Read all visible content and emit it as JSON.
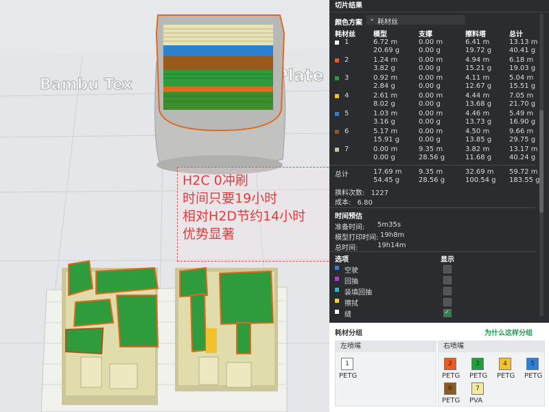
{
  "viewport": {
    "plate_label": "Bambu Tex",
    "plate_label_right": "Plate",
    "annotation": [
      "H2C 0冲刷",
      "时间只要19小时",
      "相对H2D节约14小时",
      "优势显著"
    ],
    "colors": {
      "plate_top": "#f3f3f0",
      "plate_side": "#b9bab7",
      "green": "#2e9b3c",
      "orange": "#dd6a1e",
      "cream": "#e8e3b4",
      "brown": "#9a5a1c",
      "blue": "#2d7fcf",
      "tan": "#c9b98a",
      "gray_model": "#c6c6c4"
    }
  },
  "panel": {
    "title": "切片结果",
    "color_scheme_label": "颜色方案",
    "color_scheme_value": "耗材丝",
    "columns": [
      "耗材丝",
      "模型",
      "支撑",
      "擦料塔",
      "总计"
    ],
    "filaments": [
      {
        "id": "1",
        "color": "#ffffff",
        "model_m": "6.72 m",
        "model_g": "20.69 g",
        "support_m": "0.00 m",
        "support_g": "0.00 g",
        "tower_m": "6.41 m",
        "tower_g": "19.72 g",
        "total_m": "13.13 m",
        "total_g": "40.41 g"
      },
      {
        "id": "2",
        "color": "#ea5b20",
        "model_m": "1.24 m",
        "model_g": "3.82 g",
        "support_m": "0.00 m",
        "support_g": "0.00 g",
        "tower_m": "4.94 m",
        "tower_g": "15.21 g",
        "total_m": "6.18 m",
        "total_g": "19.03 g"
      },
      {
        "id": "3",
        "color": "#1fa040",
        "model_m": "0.92 m",
        "model_g": "2.84 g",
        "support_m": "0.00 m",
        "support_g": "0.00 g",
        "tower_m": "4.11 m",
        "tower_g": "12.67 g",
        "total_m": "5.04 m",
        "total_g": "15.51 g"
      },
      {
        "id": "4",
        "color": "#f2c12e",
        "model_m": "2.61 m",
        "model_g": "8.02 g",
        "support_m": "0.00 m",
        "support_g": "0.00 g",
        "tower_m": "4.44 m",
        "tower_g": "13.68 g",
        "total_m": "7.05 m",
        "total_g": "21.70 g"
      },
      {
        "id": "5",
        "color": "#2f7fd6",
        "model_m": "1.03 m",
        "model_g": "3.16 g",
        "support_m": "0.00 m",
        "support_g": "0.00 g",
        "tower_m": "4.46 m",
        "tower_g": "13.73 g",
        "total_m": "5.49 m",
        "total_g": "16.90 g"
      },
      {
        "id": "6",
        "color": "#8b5a1e",
        "model_m": "5.17 m",
        "model_g": "15.91 g",
        "support_m": "0.00 m",
        "support_g": "0.00 g",
        "tower_m": "4.50 m",
        "tower_g": "13.85 g",
        "total_m": "9.66 m",
        "total_g": "29.75 g"
      },
      {
        "id": "7",
        "color": "#c8c0a0",
        "model_m": "0.00 m",
        "model_g": "0.00 g",
        "support_m": "9.35 m",
        "support_g": "28.56 g",
        "tower_m": "3.82 m",
        "tower_g": "11.68 g",
        "total_m": "13.17 m",
        "total_g": "40.24 g"
      }
    ],
    "totals": {
      "label": "总计",
      "model_m": "17.69 m",
      "model_g": "54.45 g",
      "support_m": "9.35 m",
      "support_g": "28.56 g",
      "tower_m": "32.69 m",
      "tower_g": "100.54 g",
      "total_m": "59.72 m",
      "total_g": "183.55 g"
    },
    "change_count": {
      "label": "换料次数:",
      "value": "1227"
    },
    "cost": {
      "label": "成本:",
      "value": "6.80"
    },
    "time": {
      "title": "时间预估",
      "prep_label": "准备时间:",
      "prep_value": "5m35s",
      "print_label": "模型打印时间:",
      "print_value": "19h8m",
      "total_label": "总时间:",
      "total_value": "19h14m"
    },
    "options": {
      "title": "选项",
      "show_label": "显示",
      "items": [
        {
          "label": "空驶",
          "color": "#3a7bd5",
          "checked": false
        },
        {
          "label": "回抽",
          "color": "#b23ad5",
          "checked": false
        },
        {
          "label": "装填回抽",
          "color": "#2fb8c9",
          "checked": false
        },
        {
          "label": "擦拭",
          "color": "#f2d22e",
          "checked": false
        },
        {
          "label": "缝",
          "color": "#ffffff",
          "checked": true
        }
      ]
    }
  },
  "groups": {
    "title": "耗材分组",
    "link": "为什么这样分组",
    "left": {
      "title": "左喷嘴",
      "items": [
        {
          "id": "1",
          "color": "#ffffff",
          "type": "PETG"
        }
      ]
    },
    "right": {
      "title": "右喷嘴",
      "items": [
        {
          "id": "2",
          "color": "#ea5b20",
          "type": "PETG"
        },
        {
          "id": "3",
          "color": "#1fa040",
          "type": "PETG"
        },
        {
          "id": "4",
          "color": "#f2c12e",
          "type": "PETG"
        },
        {
          "id": "5",
          "color": "#2f7fd6",
          "type": "PETG"
        },
        {
          "id": "6",
          "color": "#8b5a1e",
          "type": "PETG"
        },
        {
          "id": "7",
          "color": "#f2e9a0",
          "type": "PVA"
        }
      ]
    }
  }
}
